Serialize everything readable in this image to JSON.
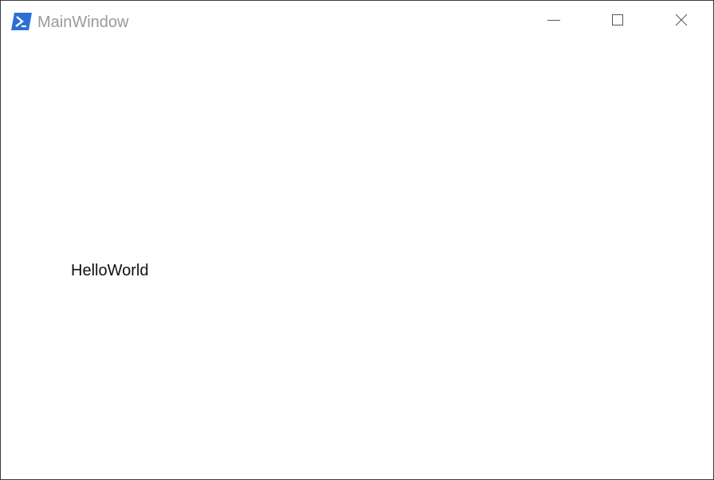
{
  "window": {
    "title": "MainWindow",
    "app_icon": "powershell-icon",
    "accent_color": "#2a6fd6",
    "controls": {
      "minimize_icon": "minimize-icon",
      "maximize_icon": "maximize-icon",
      "close_icon": "close-icon"
    }
  },
  "content": {
    "label_text": "HelloWorld"
  }
}
